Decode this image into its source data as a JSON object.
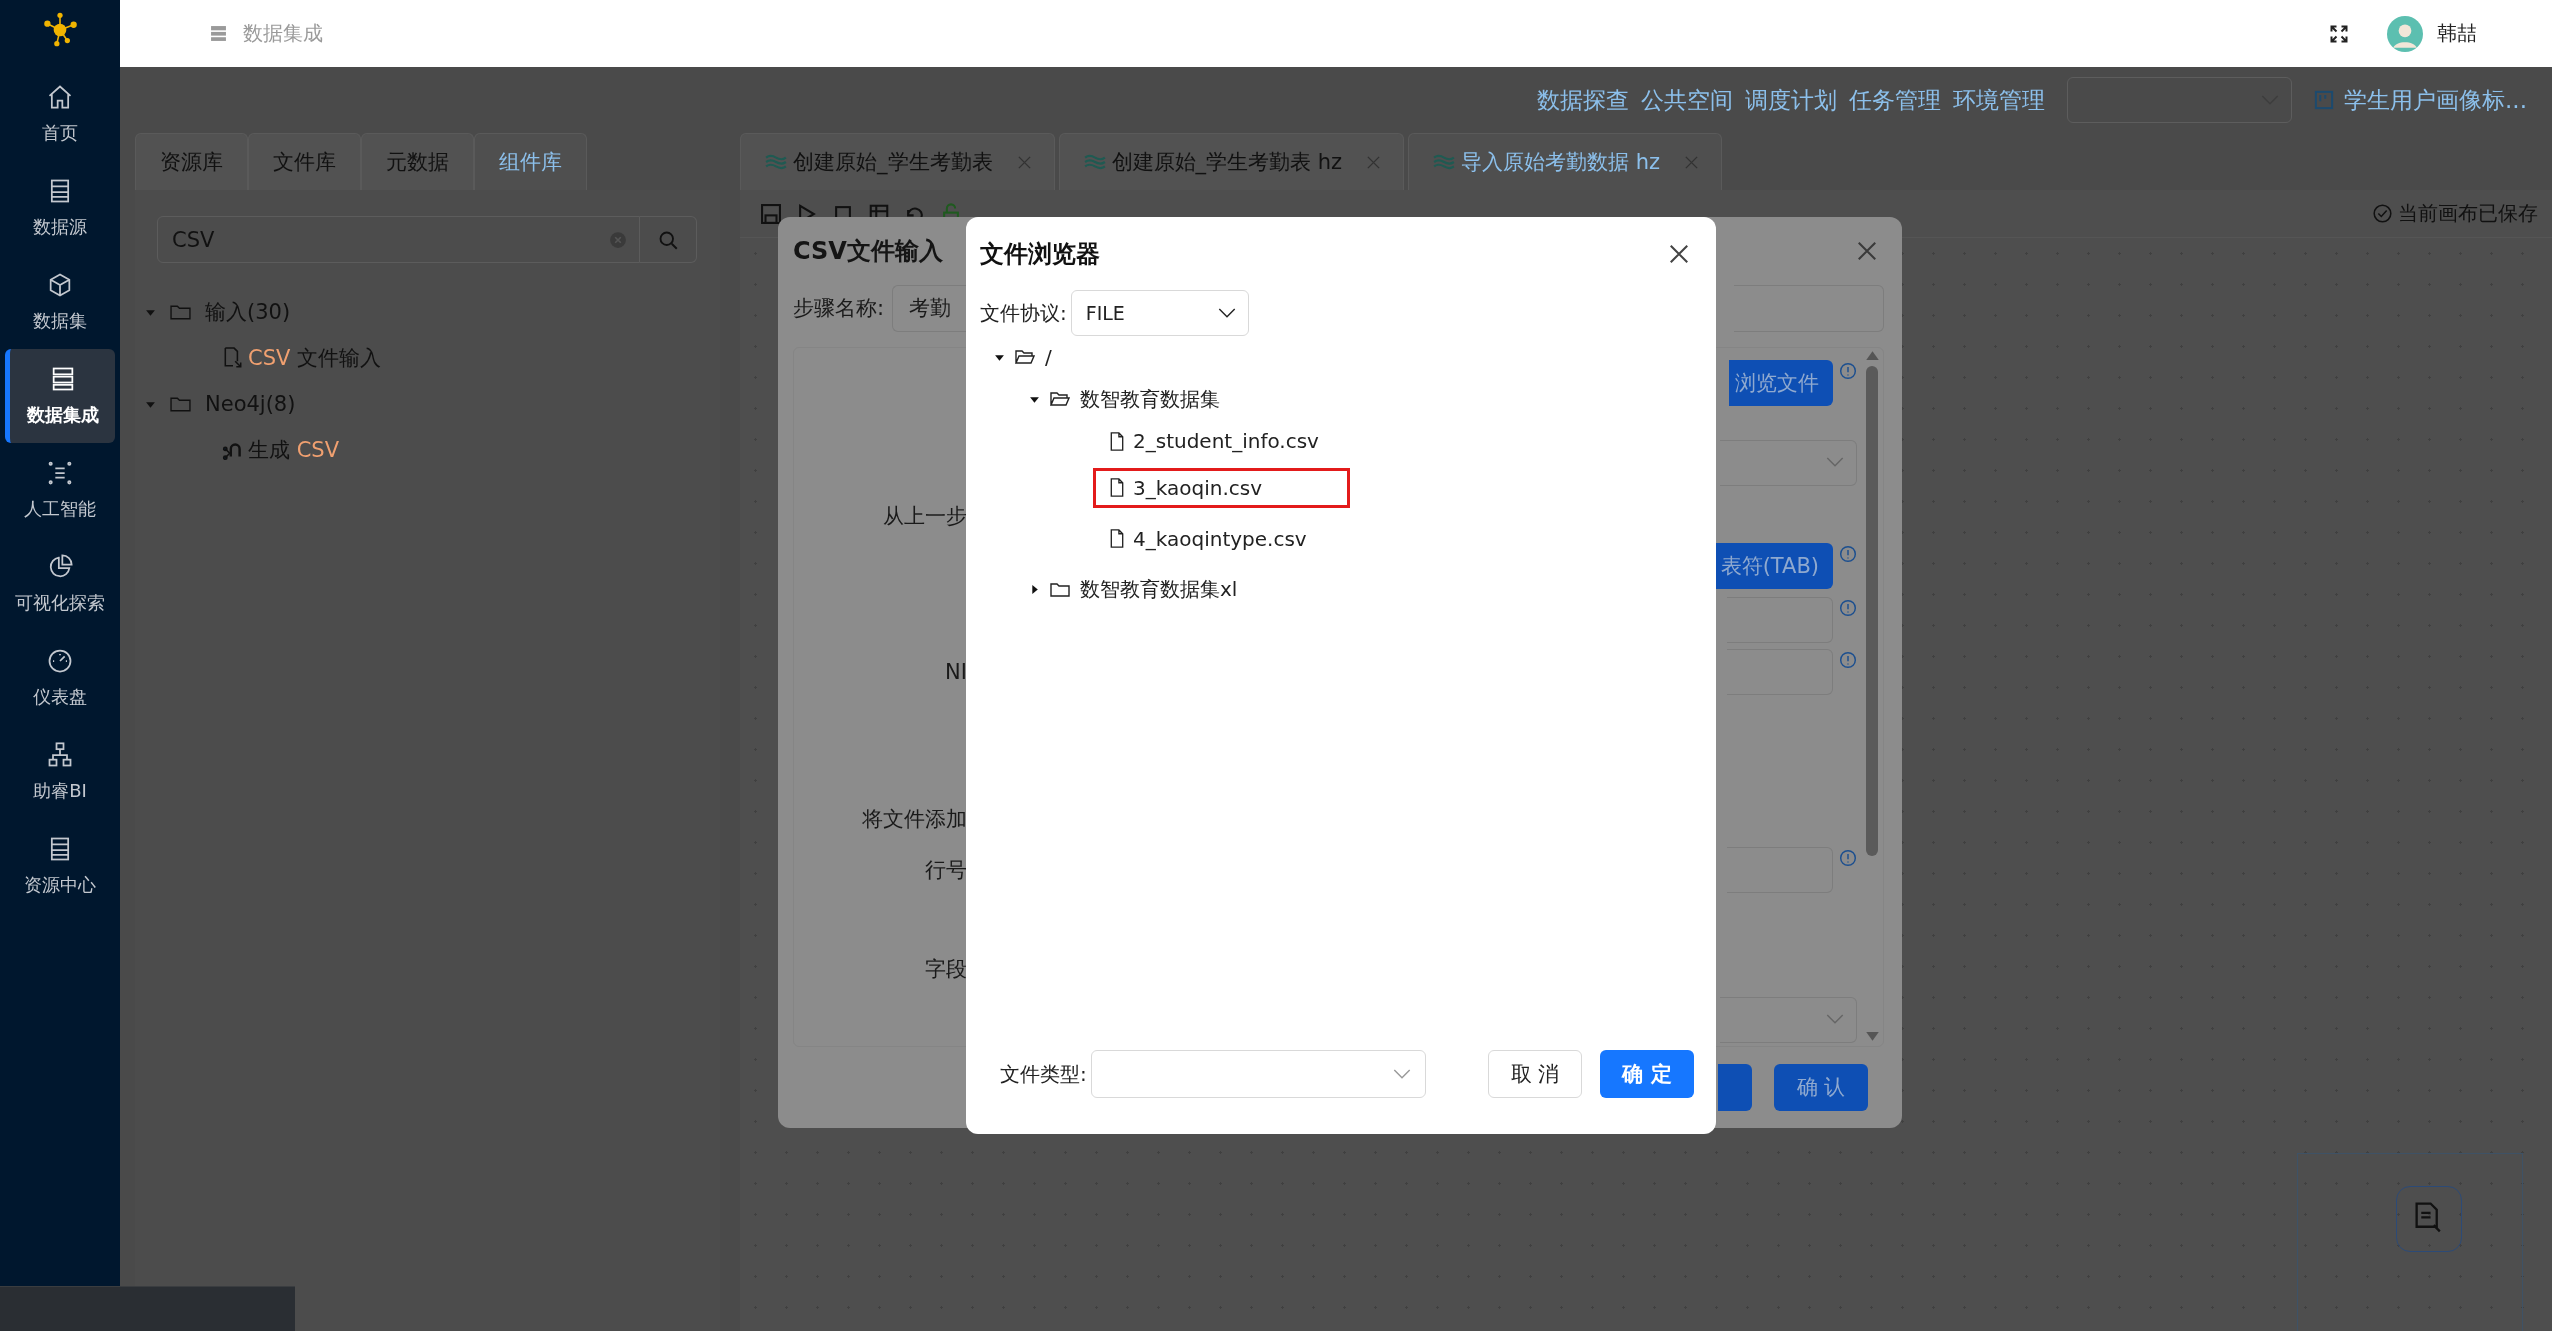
{
  "sidebar": {
    "items": [
      {
        "label": "首页",
        "selected": false
      },
      {
        "label": "数据源",
        "selected": false
      },
      {
        "label": "数据集",
        "selected": false
      },
      {
        "label": "数据集成",
        "selected": true
      },
      {
        "label": "人工智能",
        "selected": false
      },
      {
        "label": "可视化探索",
        "selected": false
      },
      {
        "label": "仪表盘",
        "selected": false
      },
      {
        "label": "助睿BI",
        "selected": false
      },
      {
        "label": "资源中心",
        "selected": false
      }
    ]
  },
  "header": {
    "title": "数据集成",
    "user_name": "韩喆"
  },
  "nav_links": [
    "数据探查",
    "公共空间",
    "调度计划",
    "任务管理",
    "环境管理"
  ],
  "project_link": "学生用户画像标...",
  "left_tabs": [
    {
      "label": "资源库",
      "selected": false
    },
    {
      "label": "文件库",
      "selected": false
    },
    {
      "label": "元数据",
      "selected": false
    },
    {
      "label": "组件库",
      "selected": true
    }
  ],
  "search": {
    "value": "CSV"
  },
  "component_tree": [
    {
      "label": "输入(30)",
      "expanded": true,
      "children": [
        {
          "label_parts": [
            {
              "text": "CSV",
              "match": true
            },
            {
              "text": " 文件输入",
              "match": false
            }
          ]
        }
      ]
    },
    {
      "label": "Neo4j(8)",
      "expanded": true,
      "children": [
        {
          "label_parts": [
            {
              "text": "生成 ",
              "match": false
            },
            {
              "text": "CSV",
              "match": true
            }
          ]
        }
      ]
    }
  ],
  "editor_tabs": [
    {
      "label": "创建原始_学生考勤表",
      "selected": false
    },
    {
      "label": "创建原始_学生考勤表 hz",
      "selected": false
    },
    {
      "label": "导入原始考勤数据 hz",
      "selected": true
    }
  ],
  "save_status": "当前画布已保存",
  "csv_dialog": {
    "title": "CSV文件输入",
    "step_name_label": "步骤名称:",
    "step_name_value": "考勤",
    "rows": [
      {
        "kind": "button",
        "text": "浏览文件",
        "info": true
      },
      {
        "kind": "select",
        "info": false
      },
      {
        "kind": "none",
        "label": "从上一步",
        "info": false
      },
      {
        "kind": "button",
        "text": "表符(TAB)",
        "info": true
      },
      {
        "kind": "input",
        "info": true
      },
      {
        "kind": "input",
        "label": "NI",
        "info": true
      },
      {
        "kind": "none",
        "label": "将文件添加",
        "info": false
      },
      {
        "kind": "input",
        "label": "行号",
        "info": true
      },
      {
        "kind": "none",
        "label": "字段",
        "info": false
      },
      {
        "kind": "select",
        "info": false
      }
    ],
    "confirm_button": "确 认"
  },
  "file_dialog": {
    "title": "文件浏览器",
    "protocol_label": "文件协议:",
    "protocol_value": "FILE",
    "tree": [
      {
        "label": "/",
        "kind": "folder",
        "expanded": true,
        "children": [
          {
            "label": "数智教育数据集",
            "kind": "folder",
            "expanded": true,
            "children": [
              {
                "label": "2_student_info.csv",
                "kind": "file",
                "highlighted": false
              },
              {
                "label": "3_kaoqin.csv",
                "kind": "file",
                "highlighted": true
              },
              {
                "label": "4_kaoqintype.csv",
                "kind": "file",
                "highlighted": false
              }
            ]
          },
          {
            "label": "数智教育数据集xl",
            "kind": "folder",
            "expanded": false
          }
        ]
      }
    ],
    "file_type_label": "文件类型:",
    "cancel_button": "取 消",
    "ok_button": "确 定"
  }
}
